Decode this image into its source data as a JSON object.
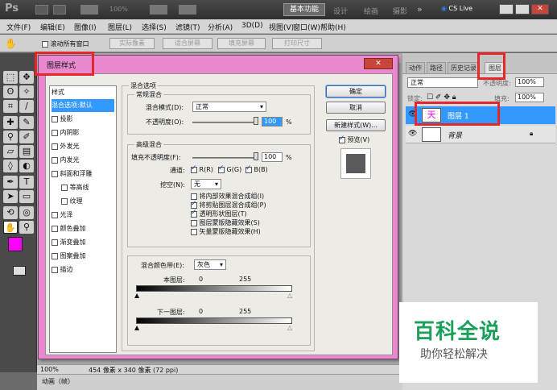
{
  "app": {
    "logo": "Ps",
    "zoom": "100%",
    "workspace": "基本功能",
    "ws_design": "设计",
    "ws_paint": "绘画",
    "ws_photo": "摄影",
    "ws_more": "»",
    "cslive": "CS Live"
  },
  "menus": [
    "文件(F)",
    "编辑(E)",
    "图像(I)",
    "图层(L)",
    "选择(S)",
    "滤镜(T)",
    "分析(A)",
    "3D(D)",
    "视图(V)",
    "窗口(W)",
    "帮助(H)"
  ],
  "options": {
    "scroll_all": "滚动所有窗口",
    "actual": "实际像素",
    "fit": "适合屏幕",
    "fill": "填充屏幕",
    "print": "打印尺寸"
  },
  "dialog": {
    "title": "图层样式",
    "styles_header": "样式",
    "styles": [
      {
        "label": "混合选项:默认",
        "checkbox": false,
        "selected": true,
        "indent": false
      },
      {
        "label": "投影",
        "checkbox": true,
        "indent": false
      },
      {
        "label": "内阴影",
        "checkbox": true,
        "indent": false
      },
      {
        "label": "外发光",
        "checkbox": true,
        "indent": false
      },
      {
        "label": "内发光",
        "checkbox": true,
        "indent": false
      },
      {
        "label": "斜面和浮雕",
        "checkbox": true,
        "indent": false
      },
      {
        "label": "等高线",
        "checkbox": true,
        "indent": true
      },
      {
        "label": "纹理",
        "checkbox": true,
        "indent": true
      },
      {
        "label": "光泽",
        "checkbox": true,
        "indent": false
      },
      {
        "label": "颜色叠加",
        "checkbox": true,
        "indent": false
      },
      {
        "label": "渐变叠加",
        "checkbox": true,
        "indent": false
      },
      {
        "label": "图案叠加",
        "checkbox": true,
        "indent": false
      },
      {
        "label": "描边",
        "checkbox": true,
        "indent": false
      }
    ],
    "blend_options_title": "混合选项",
    "general_blend": "常规混合",
    "blend_mode_label": "混合模式(D):",
    "blend_mode_value": "正常",
    "opacity_label": "不透明度(O):",
    "opacity_value": "100",
    "percent": "%",
    "advanced_blend": "高级混合",
    "fill_opacity_label": "填充不透明度(F):",
    "fill_opacity_value": "100",
    "channels_label": "通道:",
    "ch_r": "R(R)",
    "ch_g": "G(G)",
    "ch_b": "B(B)",
    "knockout_label": "挖空(N):",
    "knockout_value": "无",
    "adv_checks": [
      {
        "label": "将内部效果混合成组(I)",
        "checked": false
      },
      {
        "label": "将剪贴图层混合成组(P)",
        "checked": true
      },
      {
        "label": "透明形状图层(T)",
        "checked": true
      },
      {
        "label": "图层蒙版隐藏效果(S)",
        "checked": false
      },
      {
        "label": "矢量蒙版隐藏效果(H)",
        "checked": false
      }
    ],
    "blend_if_label": "混合颜色带(E):",
    "blend_if_value": "灰色",
    "this_layer": "本图层:",
    "underlying_layer": "下一图层:",
    "range_min": "0",
    "range_max": "255",
    "ok": "确定",
    "cancel": "取消",
    "new_style": "新建样式(W)...",
    "preview": "预览(V)"
  },
  "panel": {
    "tabs": [
      "动作",
      "路径",
      "历史记录",
      "图层"
    ],
    "blend": "正常",
    "opacity_label": "不透明度:",
    "opacity_value": "100%",
    "lock_label": "锁定:",
    "fill_label": "填充:",
    "fill_value": "100%",
    "layers": [
      {
        "name": "图层 1",
        "thumb_text": "天",
        "selected": true
      },
      {
        "name": "背景",
        "selected": false,
        "locked": true
      }
    ]
  },
  "status": {
    "zoom": "100%",
    "doc_info": "454 像素 x 340 像素 (72 ppi)"
  },
  "bottom": {
    "animation": "动画（帧）"
  },
  "watermark": {
    "title": "百科全说",
    "subtitle": "助你轻松解决"
  },
  "colors": {
    "foreground": "#ff00ff",
    "background": "#ffffff",
    "selection": "#3399ff",
    "dialog_frame": "#e98ad1",
    "annotation": "#e3272b"
  }
}
